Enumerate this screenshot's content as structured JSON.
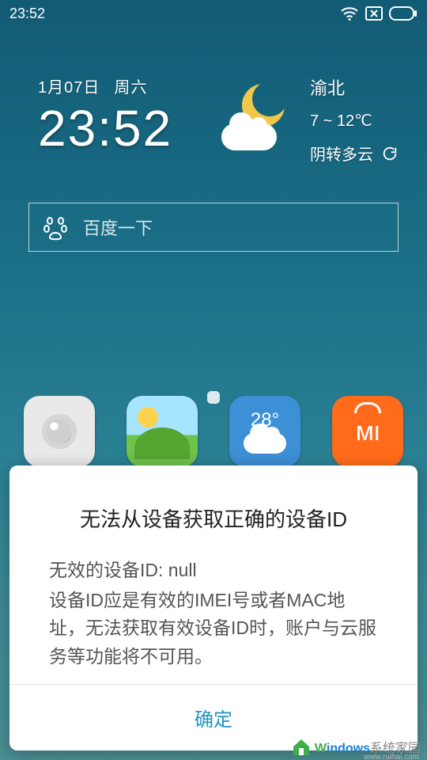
{
  "status": {
    "time": "23:52"
  },
  "widget": {
    "date": "1月07日",
    "weekday": "周六",
    "time": "23:52",
    "location": "渝北",
    "temp_range": "7 ~ 12℃",
    "condition": "阴转多云"
  },
  "search": {
    "placeholder": "百度一下"
  },
  "apps": {
    "weather_temp": "28°",
    "mi_label": "ᴍı"
  },
  "dialog": {
    "title": "无法从设备获取正确的设备ID",
    "body_line1": "无效的设备ID: null",
    "body_rest": "设备ID应是有效的IMEI号或者MAC地址，无法获取有效设备ID时，账户与云服务等功能将不可用。",
    "ok": "确定"
  },
  "watermark": {
    "brand1": "W",
    "brand2": "indows",
    "brand3": "系统家园",
    "sub": "www.ruihai.com"
  }
}
